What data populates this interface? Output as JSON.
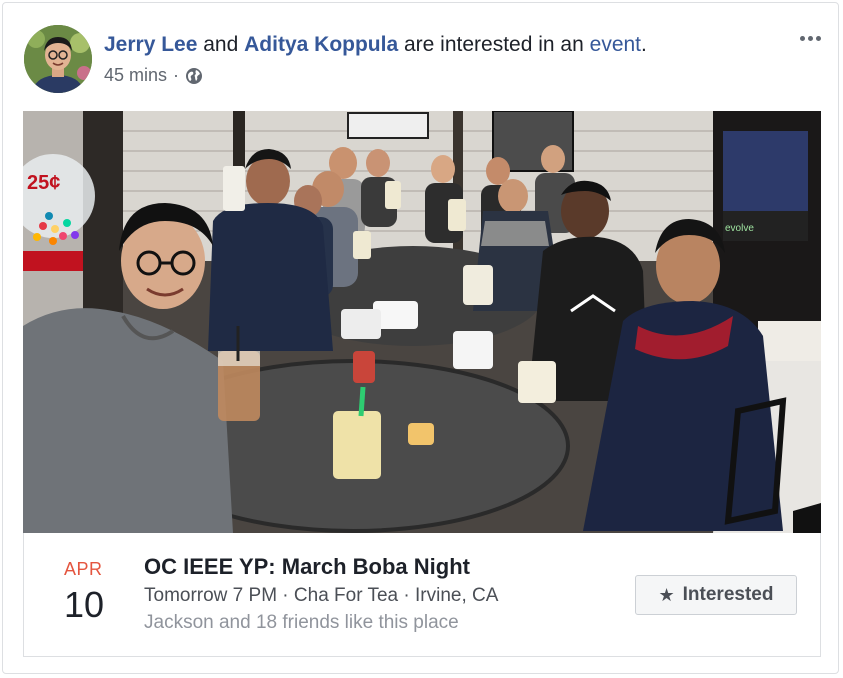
{
  "post": {
    "actor_1": "Jerry Lee",
    "connector_1": "and",
    "actor_2": "Aditya Koppula",
    "connector_2": "are interested in an",
    "object_link": "event",
    "object_punct": ".",
    "time": "45 mins",
    "separator": "·",
    "privacy_icon": "globe-icon",
    "more_icon": "ellipsis-icon"
  },
  "photo": {
    "sign_text": "25¢",
    "arcade_text": "evolve"
  },
  "event": {
    "month": "APR",
    "day": "10",
    "title": "OC IEEE YP: March Boba Night",
    "details": "Tomorrow 7 PM · Cha For Tea · Irvine, CA",
    "social": "Jackson and 18 friends like this place",
    "button_icon": "star-icon",
    "button_label": "Interested"
  },
  "colors": {
    "link": "#365899",
    "month": "#e4553f",
    "muted": "#90949c"
  }
}
